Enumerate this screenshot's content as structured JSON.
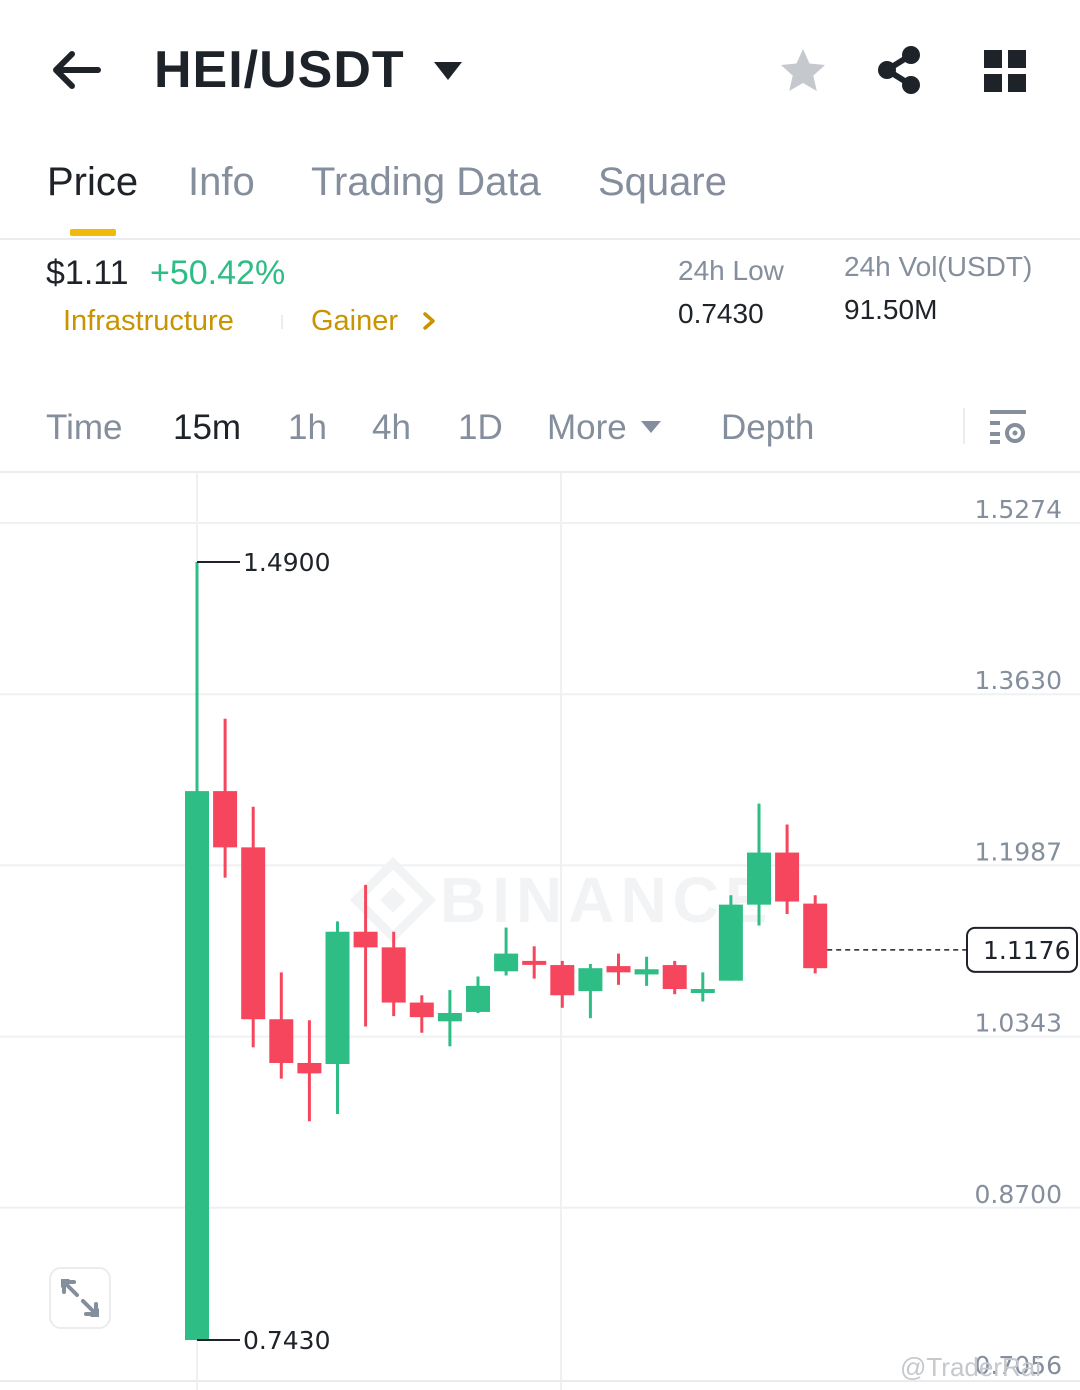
{
  "header": {
    "pair": "HEI/USDT",
    "icons": [
      "back-arrow-icon",
      "caret-down-icon",
      "star-icon",
      "share-icon",
      "grid-icon"
    ]
  },
  "tabs": [
    {
      "label": "Price",
      "active": true
    },
    {
      "label": "Info",
      "active": false
    },
    {
      "label": "Trading Data",
      "active": false
    },
    {
      "label": "Square",
      "active": false
    }
  ],
  "price_info": {
    "last_price": "$1.11",
    "change": "+50.42%",
    "tags": [
      "Infrastructure",
      "Gainer"
    ],
    "stats": [
      {
        "label": "24h Low",
        "value": "0.7430"
      },
      {
        "label": "24h Vol(USDT)",
        "value": "91.50M"
      }
    ]
  },
  "intervals": {
    "items": [
      {
        "label": "Time",
        "active": false
      },
      {
        "label": "15m",
        "active": true
      },
      {
        "label": "1h",
        "active": false
      },
      {
        "label": "4h",
        "active": false
      },
      {
        "label": "1D",
        "active": false
      },
      {
        "label": "More",
        "active": false
      },
      {
        "label": "Depth",
        "active": false
      }
    ]
  },
  "colors": {
    "up": "#2ebd85",
    "down": "#f6465d",
    "accent": "#f0b90b",
    "tag": "#c99400"
  },
  "chart_data": {
    "type": "candlestick",
    "y_ticks": [
      "1.5274",
      "1.3630",
      "1.1987",
      "1.0343",
      "0.8700",
      "0.7056"
    ],
    "current_price": "1.1176",
    "high_marker": "1.4900",
    "low_marker": "0.7430",
    "watermark": "BINANCE",
    "candles": [
      {
        "open": 0.743,
        "close": 1.27,
        "high": 1.49,
        "low": 0.743
      },
      {
        "open": 1.27,
        "close": 1.216,
        "high": 1.3395,
        "low": 1.187
      },
      {
        "open": 1.216,
        "close": 1.051,
        "high": 1.255,
        "low": 1.024
      },
      {
        "open": 1.051,
        "close": 1.009,
        "high": 1.096,
        "low": 0.994
      },
      {
        "open": 1.009,
        "close": 0.999,
        "high": 1.05,
        "low": 0.953
      },
      {
        "open": 1.008,
        "close": 1.135,
        "high": 1.145,
        "low": 0.96
      },
      {
        "open": 1.135,
        "close": 1.12,
        "high": 1.18,
        "low": 1.044
      },
      {
        "open": 1.12,
        "close": 1.067,
        "high": 1.135,
        "low": 1.054
      },
      {
        "open": 1.067,
        "close": 1.053,
        "high": 1.074,
        "low": 1.038
      },
      {
        "open": 1.049,
        "close": 1.057,
        "high": 1.079,
        "low": 1.025
      },
      {
        "open": 1.058,
        "close": 1.083,
        "high": 1.092,
        "low": 1.057
      },
      {
        "open": 1.097,
        "close": 1.114,
        "high": 1.139,
        "low": 1.093
      },
      {
        "open": 1.107,
        "close": 1.105,
        "high": 1.121,
        "low": 1.09
      },
      {
        "open": 1.103,
        "close": 1.074,
        "high": 1.107,
        "low": 1.062
      },
      {
        "open": 1.078,
        "close": 1.1,
        "high": 1.104,
        "low": 1.052
      },
      {
        "open": 1.102,
        "close": 1.096,
        "high": 1.114,
        "low": 1.084
      },
      {
        "open": 1.094,
        "close": 1.099,
        "high": 1.111,
        "low": 1.083
      },
      {
        "open": 1.103,
        "close": 1.08,
        "high": 1.107,
        "low": 1.075
      },
      {
        "open": 1.077,
        "close": 1.08,
        "high": 1.096,
        "low": 1.068
      },
      {
        "open": 1.088,
        "close": 1.161,
        "high": 1.17,
        "low": 1.088
      },
      {
        "open": 1.161,
        "close": 1.211,
        "high": 1.258,
        "low": 1.141
      },
      {
        "open": 1.211,
        "close": 1.164,
        "high": 1.238,
        "low": 1.152
      },
      {
        "open": 1.162,
        "close": 1.1,
        "high": 1.17,
        "low": 1.095
      }
    ]
  },
  "footer": {
    "credit": "@TraderRai"
  }
}
